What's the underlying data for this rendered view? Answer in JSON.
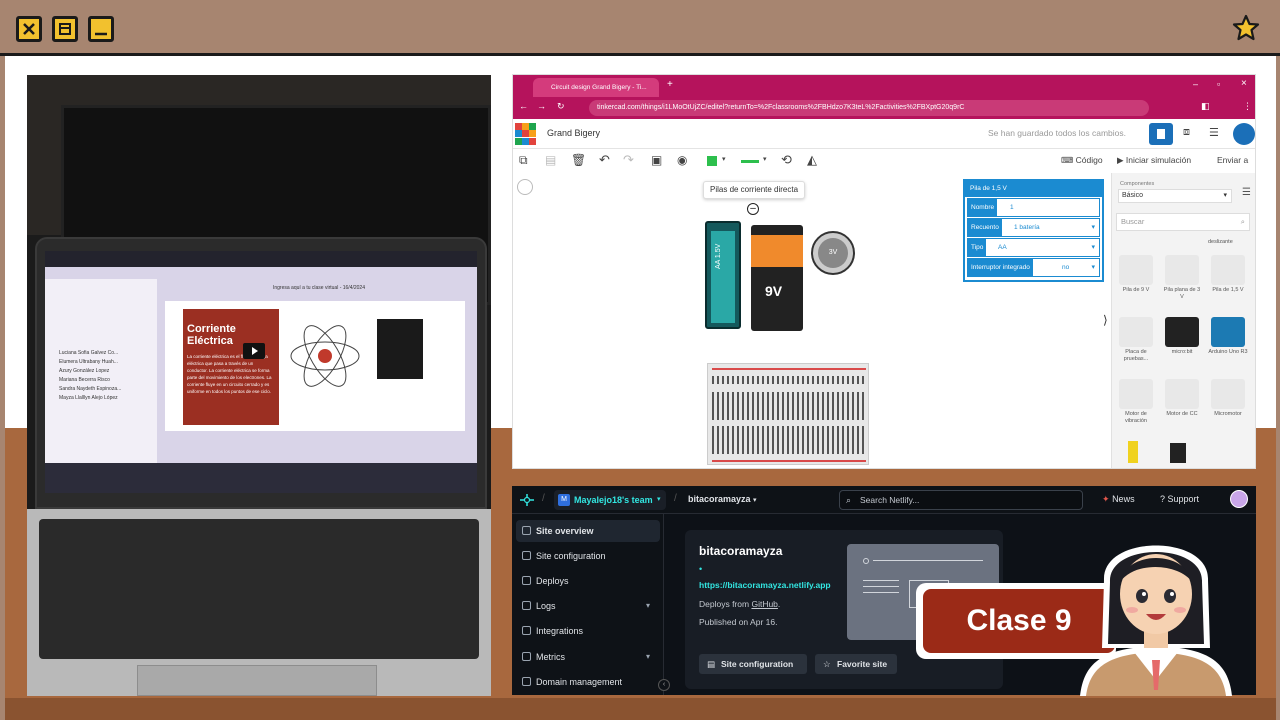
{
  "tinkercad": {
    "tab_title": "Circuit design Grand Bigery - Ti...",
    "url": "tinkercad.com/things/i1LMoOtUjZC/editel?returnTo=%2Fclassrooms%2FBHdzo7K3teL%2Factivities%2FBXptG20q9rC",
    "logo_letters": [
      "TIN",
      "KER",
      "CAD"
    ],
    "design_name": "Grand Bigery",
    "save_status": "Se han guardado todos los cambios.",
    "code_label": "Código",
    "simulate_label": "Iniciar simulación",
    "send_label": "Enviar a",
    "tooltip": "Pilas de corriente directa",
    "battery_aa_label": "AA 1.5V",
    "battery_9v_label": "9V",
    "coin_cell_label": "3V",
    "panel": {
      "title": "Pila de 1,5 V",
      "rows": [
        {
          "label": "Nombre",
          "value": "1"
        },
        {
          "label": "Recuento",
          "value": "1 batería"
        },
        {
          "label": "Tipo",
          "value": "AA"
        },
        {
          "label": "Interruptor integrado",
          "value": "no"
        }
      ]
    },
    "components": {
      "header": "Componentes",
      "category": "Básico",
      "search_placeholder": "Buscar",
      "top_label": "deslizante",
      "items": [
        {
          "label": "Pila de 9 V"
        },
        {
          "label": "Pila plana de 3 V"
        },
        {
          "label": "Pila de 1,5 V"
        },
        {
          "label": "Placa de pruebas..."
        },
        {
          "label": "micro:bit"
        },
        {
          "label": "Arduino Uno R3"
        },
        {
          "label": "Motor de vibración"
        },
        {
          "label": "Motor de CC"
        },
        {
          "label": "Micromotor"
        }
      ]
    }
  },
  "netlify": {
    "team": "Mayalejo18's team",
    "team_initial": "M",
    "site": "bitacoramayza",
    "search_placeholder": "Search Netlify...",
    "news_label": "News",
    "support_label": "Support",
    "nav": [
      {
        "label": "Site overview",
        "active": true
      },
      {
        "label": "Site configuration"
      },
      {
        "label": "Deploys"
      },
      {
        "label": "Logs",
        "chevron": true
      },
      {
        "label": "Integrations"
      },
      {
        "label": "Metrics",
        "chevron": true
      },
      {
        "label": "Domain management"
      }
    ],
    "card": {
      "site_name": "bitacoramayza",
      "url": "https://bitacoramayza.netlify.app",
      "deploys_prefix": "Deploys from",
      "deploys_source": "GitHub",
      "deploys_suffix": ".",
      "published": "Published on Apr 16.",
      "btn_config": "Site configuration",
      "btn_favorite": "Favorite site"
    }
  },
  "laptop": {
    "slide_header": "Ingresa aquí a tu clase virtual - 16/4/2024",
    "slide_title": "Corriente Eléctrica",
    "slide_text": "La corriente eléctrica es el flujo de carga eléctrica que pasa a través de un conductor. La corriente eléctrica se forma parte del movimiento de los electrones. La corriente fluye en un circuito cerrado y es uniforme en todos los puntos de ese ciclo.",
    "chat": [
      {
        "name": "Luciana Sofia Galvez Co..."
      },
      {
        "name": "Elumera Ultrabany Huah..."
      },
      {
        "name": "Azury González Lopez"
      },
      {
        "name": "Mariana Becerra Risco"
      },
      {
        "name": "Sandra Naydeth Espinoza..."
      },
      {
        "name": "Mayza Llalllyn Alejo López"
      }
    ]
  },
  "overlay": {
    "class_label": "Clase 9"
  },
  "colors": {
    "frame": "#a78570",
    "accent_yellow": "#f2c12e",
    "floor": "#a8683e",
    "clase_red": "#9b2a17",
    "tinkercad_pink": "#b5135c",
    "tinkercad_blue": "#1b8bd1",
    "netlify_teal": "#32e6e2"
  }
}
